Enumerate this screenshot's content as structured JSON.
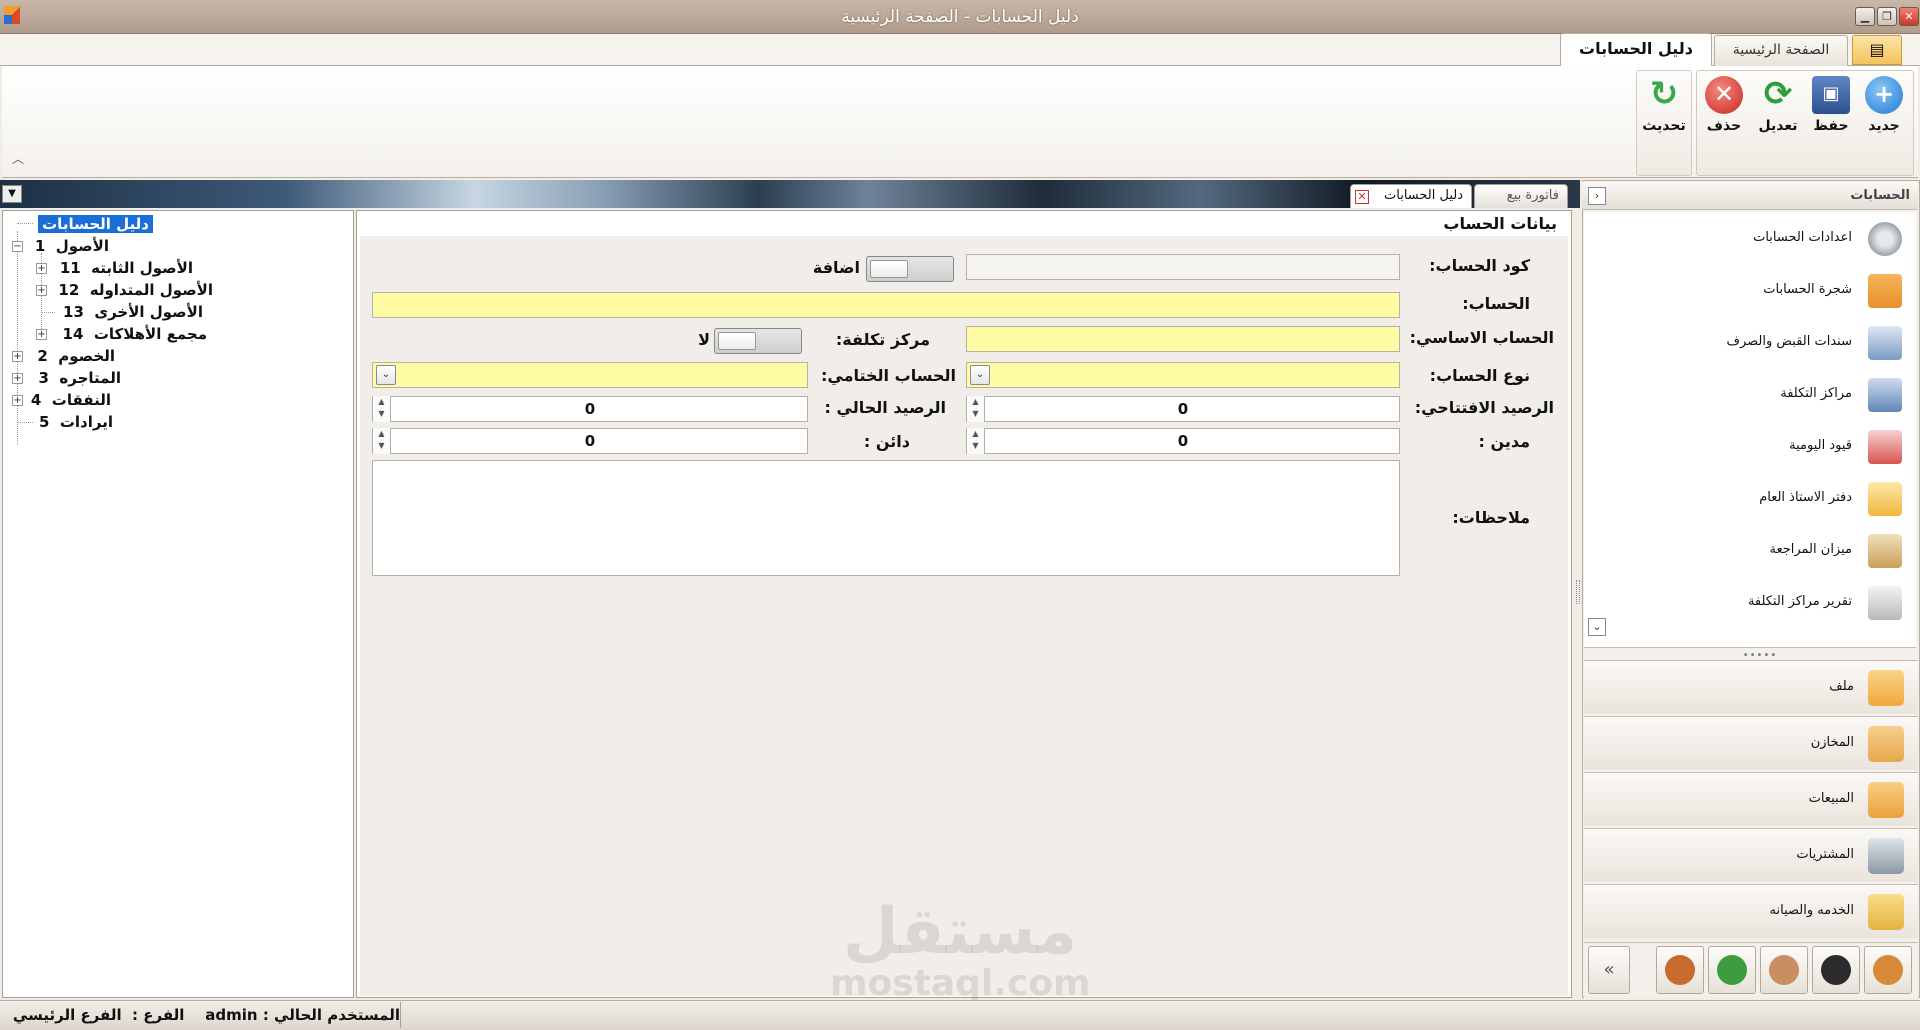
{
  "window": {
    "title": "دليل الحسابات - الصفحة الرئيسية"
  },
  "ribbon": {
    "tabs": [
      {
        "label": "دليل الحسابات",
        "active": true
      },
      {
        "label": "الصفحة الرئيسية",
        "active": false
      }
    ],
    "buttons": {
      "new": "جديد",
      "save": "حفظ",
      "edit": "تعديل",
      "delete": "حذف",
      "refresh": "تحديث"
    }
  },
  "doc_tabs": [
    {
      "label": "دليل الحسابات",
      "active": true
    },
    {
      "label": "فاتورة بيع",
      "active": false
    }
  ],
  "tree": {
    "root": "دليل الحسابات",
    "nodes": [
      {
        "code": "1",
        "name": "الأصول",
        "children": [
          {
            "code": "11",
            "name": "الأصول الثابته"
          },
          {
            "code": "12",
            "name": "الأصول المتداوله"
          },
          {
            "code": "13",
            "name": "الأصول الأخرى"
          },
          {
            "code": "14",
            "name": "مجمع الأهلاكات"
          }
        ]
      },
      {
        "code": "2",
        "name": "الخصوم"
      },
      {
        "code": "3",
        "name": "المتاجره"
      },
      {
        "code": "4",
        "name": "النفقات"
      },
      {
        "code": "5",
        "name": "ايرادات"
      }
    ]
  },
  "form": {
    "title": "بيانات الحساب",
    "labels": {
      "code": "كود الحساب:",
      "add": "اضافة",
      "account": "الحساب:",
      "main_account": "الحساب الاساسي:",
      "cost_center": "مركز تكلفة:",
      "no": "لا",
      "account_type": "نوع الحساب:",
      "final_account": "الحساب الختامي:",
      "opening_balance": "الرصيد الافتتاحي:",
      "current_balance": "الرصيد الحالي :",
      "debit": "مدين :",
      "credit": "دائن :",
      "notes": "ملاحظات:"
    },
    "values": {
      "code": "",
      "account": "",
      "main_account": "",
      "account_type": "",
      "final_account": "",
      "opening_balance": "0",
      "current_balance": "0",
      "debit": "0",
      "credit": "0",
      "notes": ""
    }
  },
  "nav": {
    "title": "الحسابات",
    "items": [
      {
        "label": "اعدادات الحسابات",
        "icon": "gears-icon",
        "color": "#9aa3ad"
      },
      {
        "label": "شجرة الحسابات",
        "icon": "tree-icon",
        "color": "#e8902c"
      },
      {
        "label": "سندات القبض والصرف",
        "icon": "voucher-icon",
        "color": "#7b9bc4"
      },
      {
        "label": "مراكز التكلفة",
        "icon": "hierarchy-icon",
        "color": "#5f87b9"
      },
      {
        "label": "قيود اليومية",
        "icon": "calendar-icon",
        "color": "#d9534f"
      },
      {
        "label": "دفتر الاستاذ العام",
        "icon": "notebook-icon",
        "color": "#f0b73e"
      },
      {
        "label": "ميزان المراجعة",
        "icon": "scale-icon",
        "color": "#c9a15a"
      },
      {
        "label": "تقرير مراكز التكلفة",
        "icon": "report-icon",
        "color": "#b8b8b8"
      }
    ],
    "categories": [
      {
        "label": "ملف",
        "icon": "file-settings-icon",
        "color": "#f0a93a"
      },
      {
        "label": "المخازن",
        "icon": "boxes-icon",
        "color": "#e6a84a"
      },
      {
        "label": "المبيعات",
        "icon": "sales-box-icon",
        "color": "#e9a23b"
      },
      {
        "label": "المشتريات",
        "icon": "cart-icon",
        "color": "#8b98a6"
      },
      {
        "label": "الخدمه والصيانه",
        "icon": "bus-icon",
        "color": "#e4b440"
      }
    ],
    "bottom_icons": [
      {
        "icon": "users-icon",
        "color": "#d88a3a"
      },
      {
        "icon": "user-dark-icon",
        "color": "#2b2b2b"
      },
      {
        "icon": "user-icon",
        "color": "#c98e62"
      },
      {
        "icon": "money-icon",
        "color": "#3e9c3e"
      },
      {
        "icon": "desk-user-icon",
        "color": "#c96a2e"
      }
    ]
  },
  "status": {
    "text": "المستخدم الحالي : admin    الفرع :  الفرع الرئيسي"
  },
  "watermark": {
    "line1": "مستقل",
    "line2": "mostaql.com"
  }
}
